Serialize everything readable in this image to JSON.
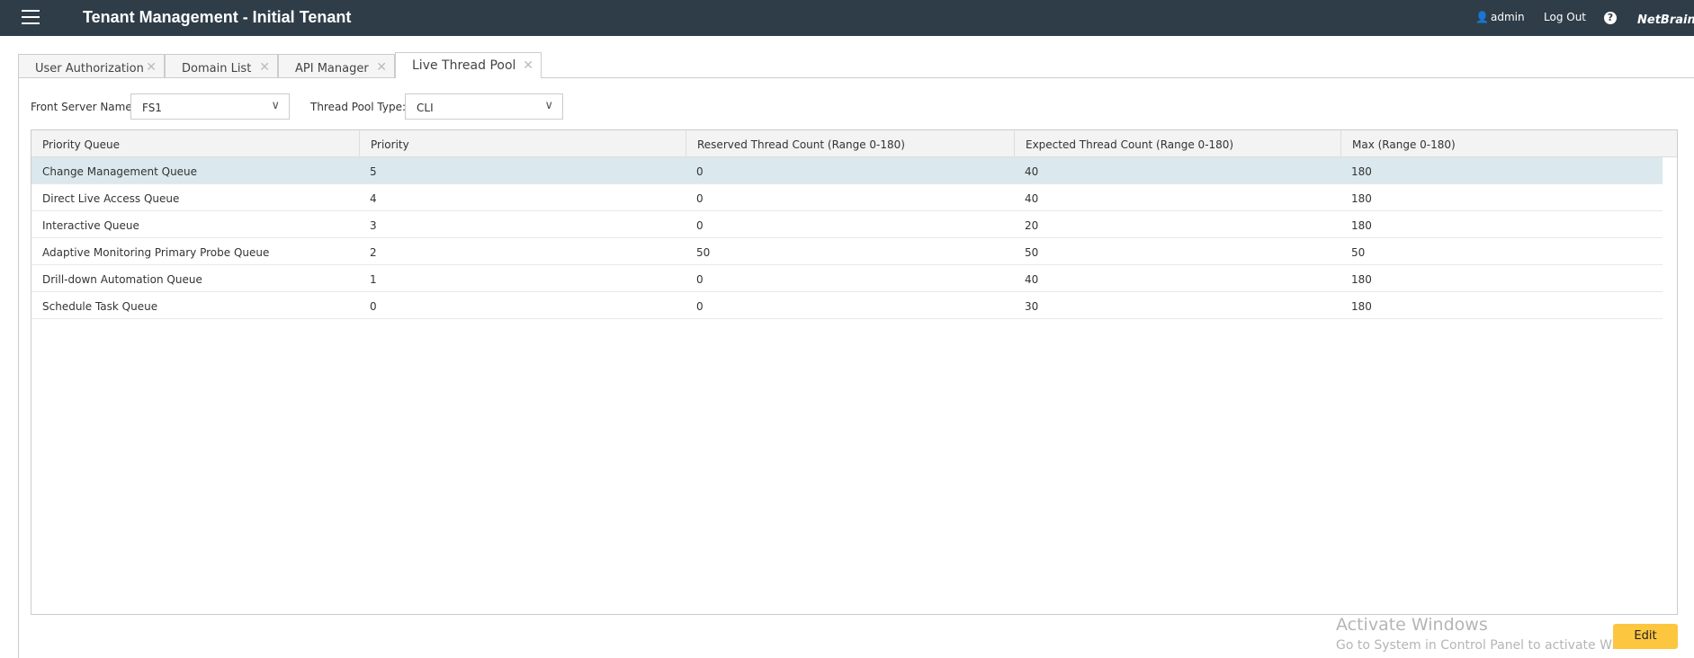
{
  "header": {
    "title": "Tenant Management - Initial Tenant",
    "user": "admin",
    "logout": "Log Out",
    "help": "?",
    "logo": "NetBrain"
  },
  "tabs": [
    {
      "label": "User Authorization"
    },
    {
      "label": "Domain List"
    },
    {
      "label": "API Manager"
    },
    {
      "label": "Live Thread Pool",
      "active": true
    }
  ],
  "filters": {
    "server_label": "Front Server Name:",
    "server_value": "FS1",
    "type_label": "Thread Pool Type:",
    "type_value": "CLI"
  },
  "table": {
    "columns": [
      "Priority Queue",
      "Priority",
      "Reserved Thread Count (Range 0-180)",
      "Expected Thread Count (Range 0-180)",
      "Max (Range 0-180)"
    ],
    "rows": [
      [
        "Change Management Queue",
        "5",
        "0",
        "40",
        "180"
      ],
      [
        "Direct Live Access Queue",
        "4",
        "0",
        "40",
        "180"
      ],
      [
        "Interactive Queue",
        "3",
        "0",
        "20",
        "180"
      ],
      [
        "Adaptive Monitoring Primary Probe Queue",
        "2",
        "50",
        "50",
        "50"
      ],
      [
        "Drill-down Automation Queue",
        "1",
        "0",
        "40",
        "180"
      ],
      [
        "Schedule Task Queue",
        "0",
        "0",
        "30",
        "180"
      ]
    ],
    "selected_row": 0
  },
  "edit_label": "Edit",
  "watermark": {
    "title": "Activate Windows",
    "subtitle": "Go to System in Control Panel to activate Windows."
  },
  "colors": {
    "header": "#2f3d48",
    "edit": "#fdc63f",
    "selected": "#dbe8ee"
  }
}
